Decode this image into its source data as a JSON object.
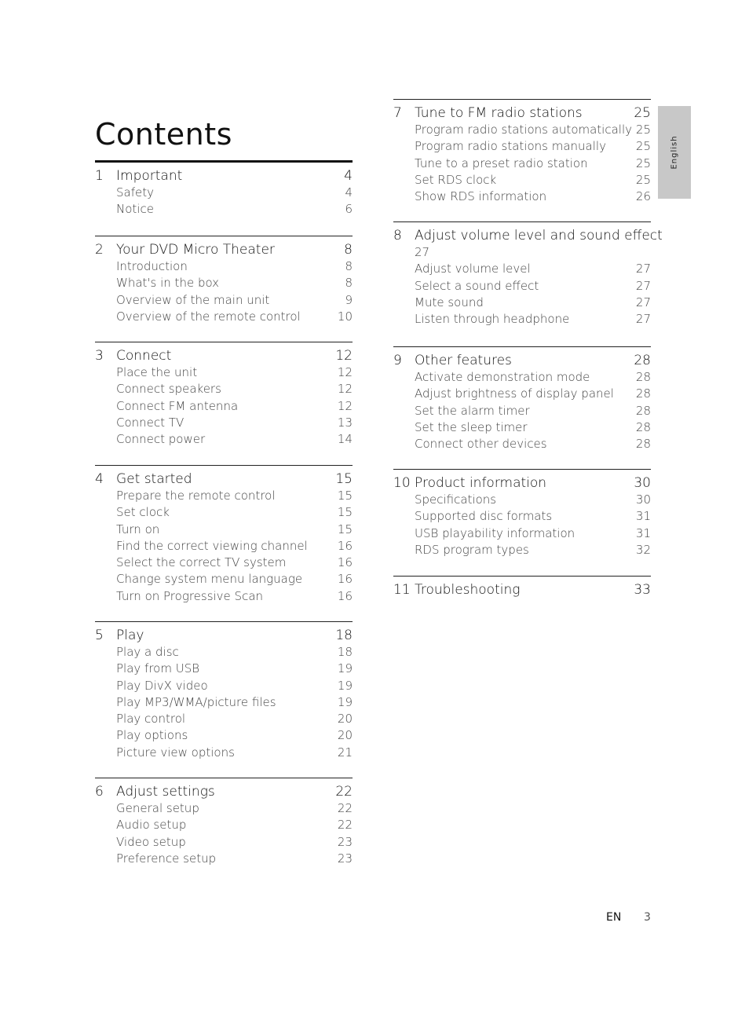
{
  "title": "Contents",
  "side_tab": "English",
  "footer": {
    "lang": "EN",
    "page": "3"
  },
  "sections": [
    {
      "num": "1",
      "title": "Important",
      "page": "4",
      "items": [
        {
          "label": "Safety",
          "page": "4"
        },
        {
          "label": "Notice",
          "page": "6"
        }
      ]
    },
    {
      "num": "2",
      "title": "Your DVD Micro Theater",
      "page": "8",
      "items": [
        {
          "label": "Introduction",
          "page": "8"
        },
        {
          "label": "What's in the box",
          "page": "8"
        },
        {
          "label": "Overview of the main unit",
          "page": "9"
        },
        {
          "label": "Overview of the remote control",
          "page": "10"
        }
      ]
    },
    {
      "num": "3",
      "title": "Connect",
      "page": "12",
      "items": [
        {
          "label": "Place the unit",
          "page": "12"
        },
        {
          "label": "Connect speakers",
          "page": "12"
        },
        {
          "label": "Connect FM antenna",
          "page": "12"
        },
        {
          "label": "Connect TV",
          "page": "13"
        },
        {
          "label": "Connect power",
          "page": "14"
        }
      ]
    },
    {
      "num": "4",
      "title": "Get started",
      "page": "15",
      "items": [
        {
          "label": "Prepare the remote control",
          "page": "15"
        },
        {
          "label": "Set clock",
          "page": "15"
        },
        {
          "label": "Turn on",
          "page": "15"
        },
        {
          "label": "Find the correct viewing channel",
          "page": "16"
        },
        {
          "label": "Select the correct TV system",
          "page": "16"
        },
        {
          "label": "Change system menu language",
          "page": "16"
        },
        {
          "label": "Turn on Progressive Scan",
          "page": "16"
        }
      ]
    },
    {
      "num": "5",
      "title": "Play",
      "page": "18",
      "items": [
        {
          "label": "Play a disc",
          "page": "18"
        },
        {
          "label": "Play from USB",
          "page": "19"
        },
        {
          "label": "Play DivX video",
          "page": "19"
        },
        {
          "label": "Play MP3/WMA/picture files",
          "page": "19"
        },
        {
          "label": "Play control",
          "page": "20"
        },
        {
          "label": "Play options",
          "page": "20"
        },
        {
          "label": "Picture view options",
          "page": "21"
        }
      ]
    },
    {
      "num": "6",
      "title": "Adjust settings",
      "page": "22",
      "items": [
        {
          "label": "General setup",
          "page": "22"
        },
        {
          "label": "Audio setup",
          "page": "22"
        },
        {
          "label": "Video setup",
          "page": "23"
        },
        {
          "label": "Preference setup",
          "page": "23"
        }
      ]
    },
    {
      "num": "7",
      "title": "Tune to FM radio stations",
      "page": "25",
      "items": [
        {
          "label": "Program radio stations automatically",
          "page": "25"
        },
        {
          "label": "Program radio stations manually",
          "page": "25"
        },
        {
          "label": "Tune to a preset radio station",
          "page": "25"
        },
        {
          "label": "Set RDS clock",
          "page": "25"
        },
        {
          "label": "Show RDS information",
          "page": "26"
        }
      ]
    },
    {
      "num": "8",
      "title": "Adjust volume level and sound effect",
      "page": "27",
      "wrap": true,
      "items": [
        {
          "label": "Adjust volume level",
          "page": "27"
        },
        {
          "label": "Select a sound effect",
          "page": "27"
        },
        {
          "label": "Mute sound",
          "page": "27"
        },
        {
          "label": "Listen through headphone",
          "page": "27"
        }
      ]
    },
    {
      "num": "9",
      "title": "Other features",
      "page": "28",
      "items": [
        {
          "label": "Activate demonstration mode",
          "page": "28"
        },
        {
          "label": "Adjust brightness of display panel",
          "page": "28"
        },
        {
          "label": "Set the alarm timer",
          "page": "28"
        },
        {
          "label": "Set the sleep timer",
          "page": "28"
        },
        {
          "label": "Connect other devices",
          "page": "28"
        }
      ]
    },
    {
      "num": "10",
      "title": "Product information",
      "page": "30",
      "items": [
        {
          "label": "Specifications",
          "page": "30"
        },
        {
          "label": "Supported disc formats",
          "page": "31"
        },
        {
          "label": "USB playability information",
          "page": "31"
        },
        {
          "label": "RDS program types",
          "page": "32"
        }
      ]
    },
    {
      "num": "11",
      "title": "Troubleshooting",
      "page": "33",
      "items": []
    }
  ]
}
